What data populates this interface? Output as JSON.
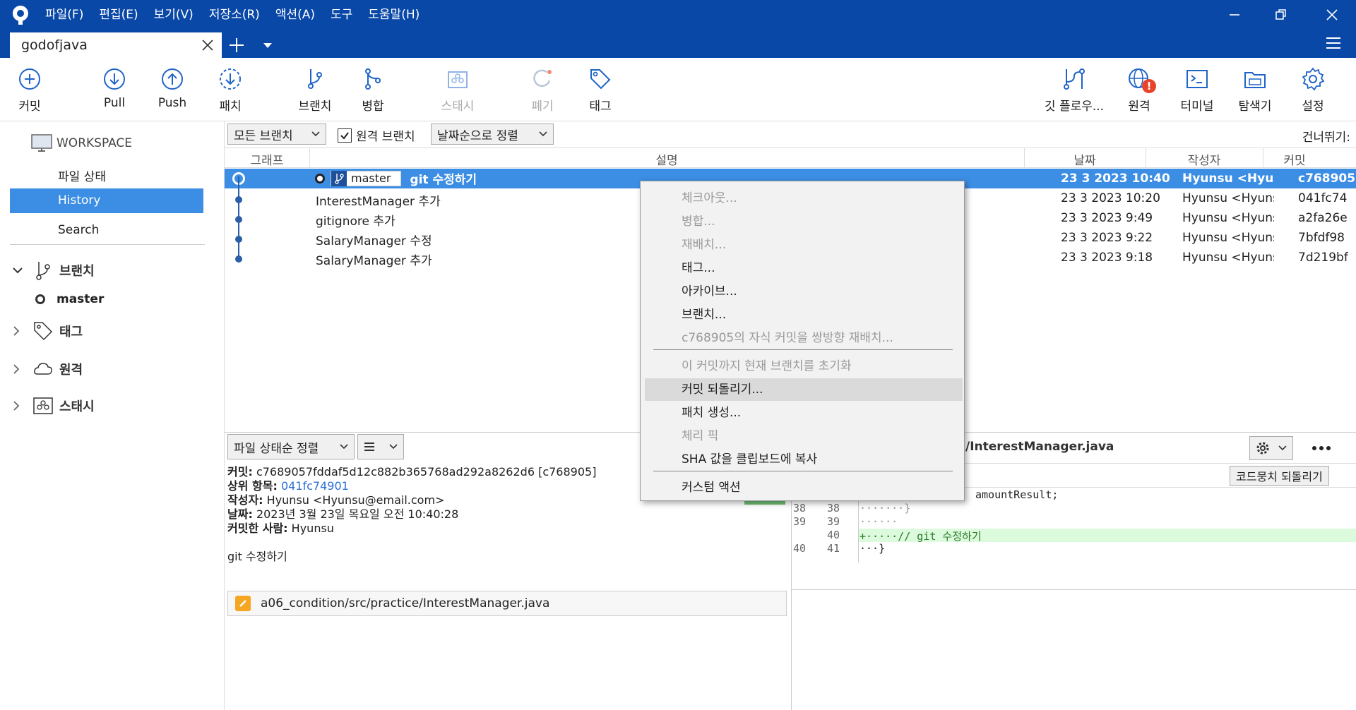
{
  "window": {
    "menu": [
      "파일(F)",
      "편집(E)",
      "보기(V)",
      "저장소(R)",
      "액션(A)",
      "도구",
      "도움말(H)"
    ],
    "tab_title": "godofjava"
  },
  "toolbar": {
    "commit": "커밋",
    "pull": "Pull",
    "push": "Push",
    "fetch": "패치",
    "branch": "브랜치",
    "merge": "병합",
    "stash": "스태시",
    "discard": "폐기",
    "tag": "태그",
    "gitflow": "깃 플로우...",
    "remote": "원격",
    "terminal": "터미널",
    "explorer": "탐색기",
    "settings": "설정"
  },
  "sidebar": {
    "workspace": "WORKSPACE",
    "file_status": "파일 상태",
    "history": "History",
    "search": "Search",
    "branches": "브랜치",
    "branch_master": "master",
    "tags": "태그",
    "remotes": "원격",
    "stashes": "스태시"
  },
  "filters": {
    "all_branches": "모든 브랜치",
    "remote_branches": "원격 브랜치",
    "sort": "날짜순으로 정렬",
    "skip": "건너뛰기:"
  },
  "columns": {
    "graph": "그래프",
    "desc": "설명",
    "date": "날짜",
    "author": "작성자",
    "commit": "커밋"
  },
  "commits": [
    {
      "branch": "master",
      "desc": "git 수정하기",
      "date": "23 3 2023 10:40",
      "author": "Hyunsu <Hyunsu",
      "hash": "c768905"
    },
    {
      "desc": "InterestManager 추가",
      "date": "23 3 2023 10:20",
      "author": "Hyunsu <Hyunsu@",
      "hash": "041fc74"
    },
    {
      "desc": "gitignore 추가",
      "date": "23 3 2023 9:49",
      "author": "Hyunsu <Hyunsu@",
      "hash": "a2fa26e"
    },
    {
      "desc": "SalaryManager 수정",
      "date": "23 3 2023 9:22",
      "author": "Hyunsu <Hyunsu@",
      "hash": "7bfdf98"
    },
    {
      "desc": "SalaryManager 추가",
      "date": "23 3 2023 9:18",
      "author": "Hyunsu <Hyunsu@",
      "hash": "7d219bf"
    }
  ],
  "details": {
    "sort": "파일 상태순 정렬",
    "commit_label": "커밋:",
    "commit_value": "c7689057fddaf5d12c882b365768ad292a8262d6 [c768905]",
    "parent_label": "상위 항목:",
    "parent_value": "041fc74901",
    "author_label": "작성자:",
    "author_value": "Hyunsu <Hyunsu@email.com>",
    "date_label": "날짜:",
    "date_value": "2023년 3월 23일 목요일 오전 10:40:28",
    "committer_label": "커밋한 사람:",
    "committer_value": "Hyunsu",
    "message": "git 수정하기",
    "file": "a06_condition/src/practice/InterestManager.java"
  },
  "diff": {
    "filename": "/InterestManager.java",
    "revert_hunk": "코드뭉치 되돌리기",
    "lines": [
      {
        "old": "",
        "new": "",
        "text": "amountResult;"
      },
      {
        "old": "38",
        "new": "38",
        "text": "·······}"
      },
      {
        "old": "39",
        "new": "39",
        "text": "······"
      },
      {
        "old": "",
        "new": "40",
        "text": "+·····// git 수정하기"
      },
      {
        "old": "40",
        "new": "41",
        "text": "···}"
      }
    ]
  },
  "context_menu": {
    "checkout": "체크아웃...",
    "merge": "병합...",
    "rebase": "재배치...",
    "tag": "태그...",
    "archive": "아카이브...",
    "branch": "브랜치...",
    "rebase_children": "c768905의 자식 커밋을 쌍방향 재배치...",
    "reset": "이 커밋까지 현재 브랜치를 초기화",
    "revert": "커밋 되돌리기...",
    "create_patch": "패치 생성...",
    "cherry_pick": "체리 픽",
    "copy_sha": "SHA 값을 클립보드에 복사",
    "custom_actions": "커스텀 액션"
  },
  "colors": {
    "titlebar": "#0A48A8",
    "selection": "#3C8EE4",
    "added_line": "#dcfadc",
    "notification": "#e8442a"
  }
}
